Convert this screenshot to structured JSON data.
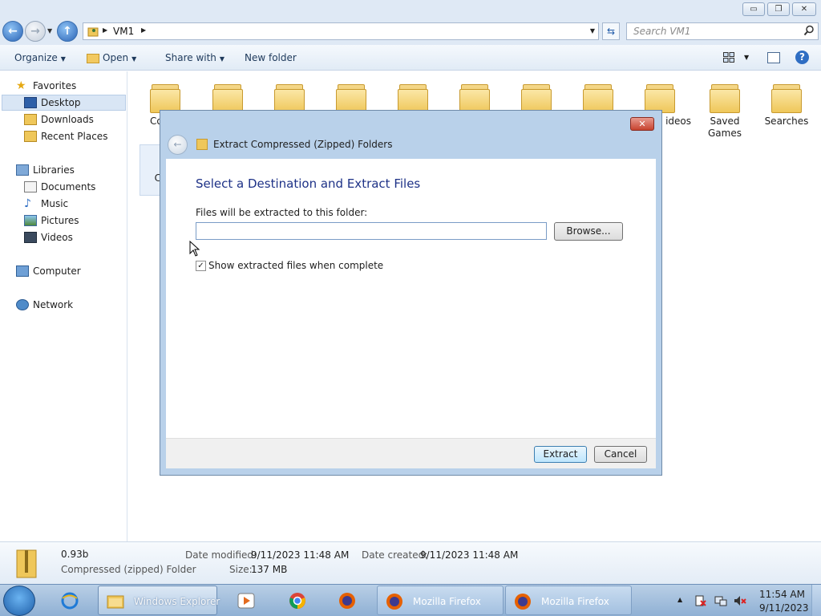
{
  "window": {
    "min_glyph": "▭",
    "max_glyph": "❐",
    "close_glyph": "✕"
  },
  "address": {
    "path": "VM1",
    "search_placeholder": "Search VM1"
  },
  "toolbar": {
    "organize": "Organize",
    "open": "Open",
    "share": "Share with",
    "new_folder": "New folder"
  },
  "sidebar": {
    "favorites": "Favorites",
    "desktop": "Desktop",
    "downloads": "Downloads",
    "recent_places": "Recent Places",
    "libraries": "Libraries",
    "documents": "Documents",
    "music": "Music",
    "pictures": "Pictures",
    "videos": "Videos",
    "computer": "Computer",
    "network": "Network"
  },
  "folders": {
    "contacts_partial": "Co",
    "videos_partial": "ideos",
    "saved_games_1": "Saved",
    "saved_games_2": "Games",
    "searches": "Searches",
    "zip_partial": "C"
  },
  "dialog": {
    "title": "Extract Compressed (Zipped) Folders",
    "heading": "Select a Destination and Extract Files",
    "label": "Files will be extracted to this folder:",
    "path_value": "",
    "browse": "Browse...",
    "show_files_checked": true,
    "show_files_label": "Show extracted files when complete",
    "extract": "Extract",
    "cancel": "Cancel"
  },
  "details": {
    "name": "0.93b",
    "type": "Compressed (zipped) Folder",
    "date_modified_label": "Date modified:",
    "date_modified": "9/11/2023 11:48 AM",
    "date_created_label": "Date created:",
    "date_created": "9/11/2023 11:48 AM",
    "size_label": "Size:",
    "size": "137 MB"
  },
  "taskbar": {
    "explorer": "Windows Explorer",
    "firefox1": "Mozilla Firefox",
    "firefox2": "Mozilla Firefox",
    "time": "11:54 AM",
    "date": "9/11/2023"
  },
  "colors": {
    "folder": "#efc75a",
    "accent_blue": "#1e3287",
    "taskbar": "#9fbadb"
  }
}
